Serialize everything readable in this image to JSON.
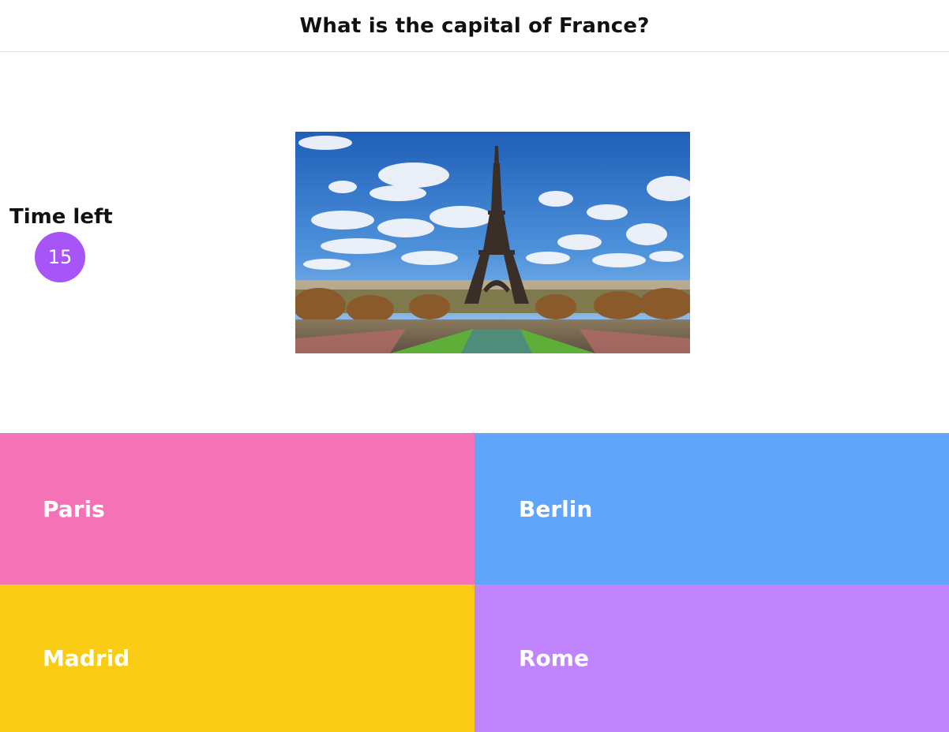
{
  "header": {
    "question": "What is the capital of France?"
  },
  "timer": {
    "label": "Time left",
    "seconds": "15",
    "color": "#a855f7"
  },
  "image": {
    "icon": "eiffel-tower-photo"
  },
  "answers": [
    {
      "label": "Paris",
      "color": "#f472b6"
    },
    {
      "label": "Berlin",
      "color": "#60a5fa"
    },
    {
      "label": "Madrid",
      "color": "#facc15"
    },
    {
      "label": "Rome",
      "color": "#c084fc"
    }
  ]
}
